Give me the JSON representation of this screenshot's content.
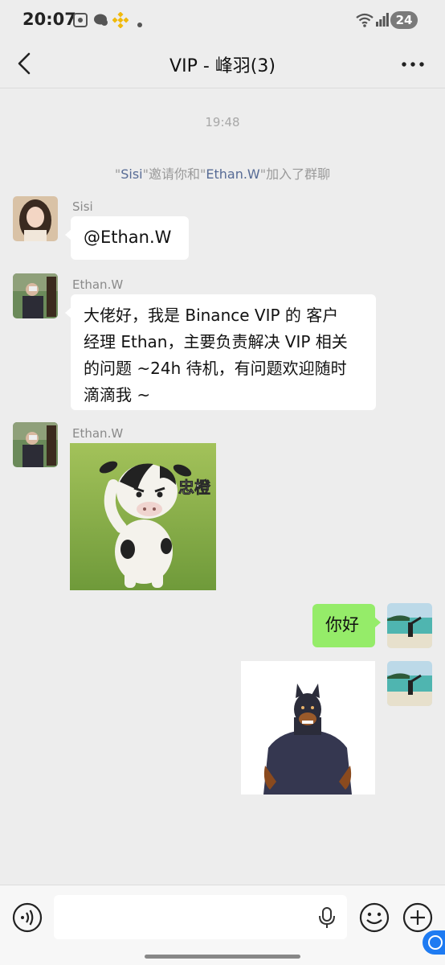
{
  "status_bar": {
    "time": "20:07",
    "battery": "24",
    "icons": [
      "screenshot-icon",
      "chat-bubble-icon",
      "binance-icon",
      "dot-icon",
      "wifi-icon",
      "signal-icon"
    ]
  },
  "nav": {
    "title": "VIP - 峰羽(3)",
    "back_icon": "chevron-left-icon",
    "more_icon": "more-dots-icon"
  },
  "chat": {
    "time_label": "19:48",
    "system": {
      "q1": "\"",
      "inviter": "Sisi",
      "mid": "\"邀请你和\"",
      "invitee": "Ethan.W",
      "tail": "\"加入了群聊"
    },
    "messages": [
      {
        "sender": "Sisi",
        "text": "@Ethan.W"
      },
      {
        "sender": "Ethan.W",
        "lines": [
          "大佬好，我是 Binance VIP 的 客户",
          "经理 Ethan，主要负责解决 VIP 相关",
          "的问题 ~24h 待机，有问题欢迎随时",
          "滴滴我 ~"
        ]
      },
      {
        "sender": "Ethan.W",
        "sticker_text": "忠橙"
      },
      {
        "sender": "me",
        "text": "你好"
      }
    ]
  },
  "input_bar": {
    "placeholder": "",
    "icons": [
      "voice-icon",
      "mic-icon",
      "emoji-icon",
      "plus-icon"
    ]
  },
  "colors": {
    "background": "#ededed",
    "bubble_self": "#95ec69",
    "bubble_other": "#ffffff",
    "link_name": "#576b95"
  }
}
